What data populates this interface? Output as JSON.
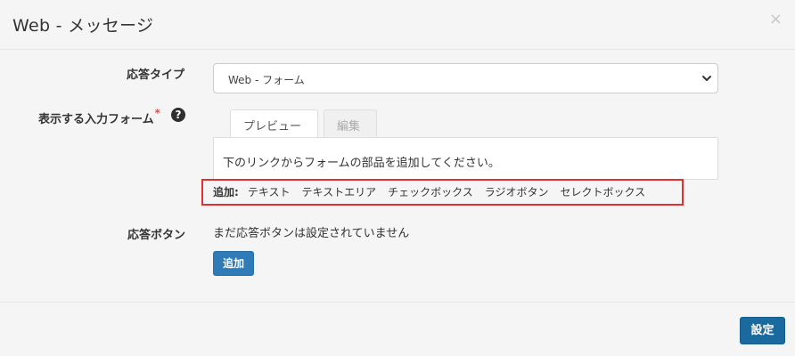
{
  "modal": {
    "title": "Web - メッセージ",
    "close": "×"
  },
  "response_type": {
    "label": "応答タイプ",
    "selected": "Web - フォーム"
  },
  "form": {
    "label": "表示する入力フォーム",
    "required_mark": "*",
    "help": "?",
    "tabs": [
      "プレビュー",
      "編集"
    ],
    "preview_text": "下のリンクからフォームの部品を追加してください。",
    "add_label": "追加:",
    "add_links": [
      "テキスト",
      "テキストエリア",
      "チェックボックス",
      "ラジオボタン",
      "セレクトボックス"
    ]
  },
  "response_button": {
    "label": "応答ボタン",
    "empty_text": "まだ応答ボタンは設定されていません",
    "add_button": "追加"
  },
  "footer": {
    "submit_button": "設定"
  },
  "colors": {
    "primary": "#2e7bb8",
    "highlight": "#e03030"
  }
}
